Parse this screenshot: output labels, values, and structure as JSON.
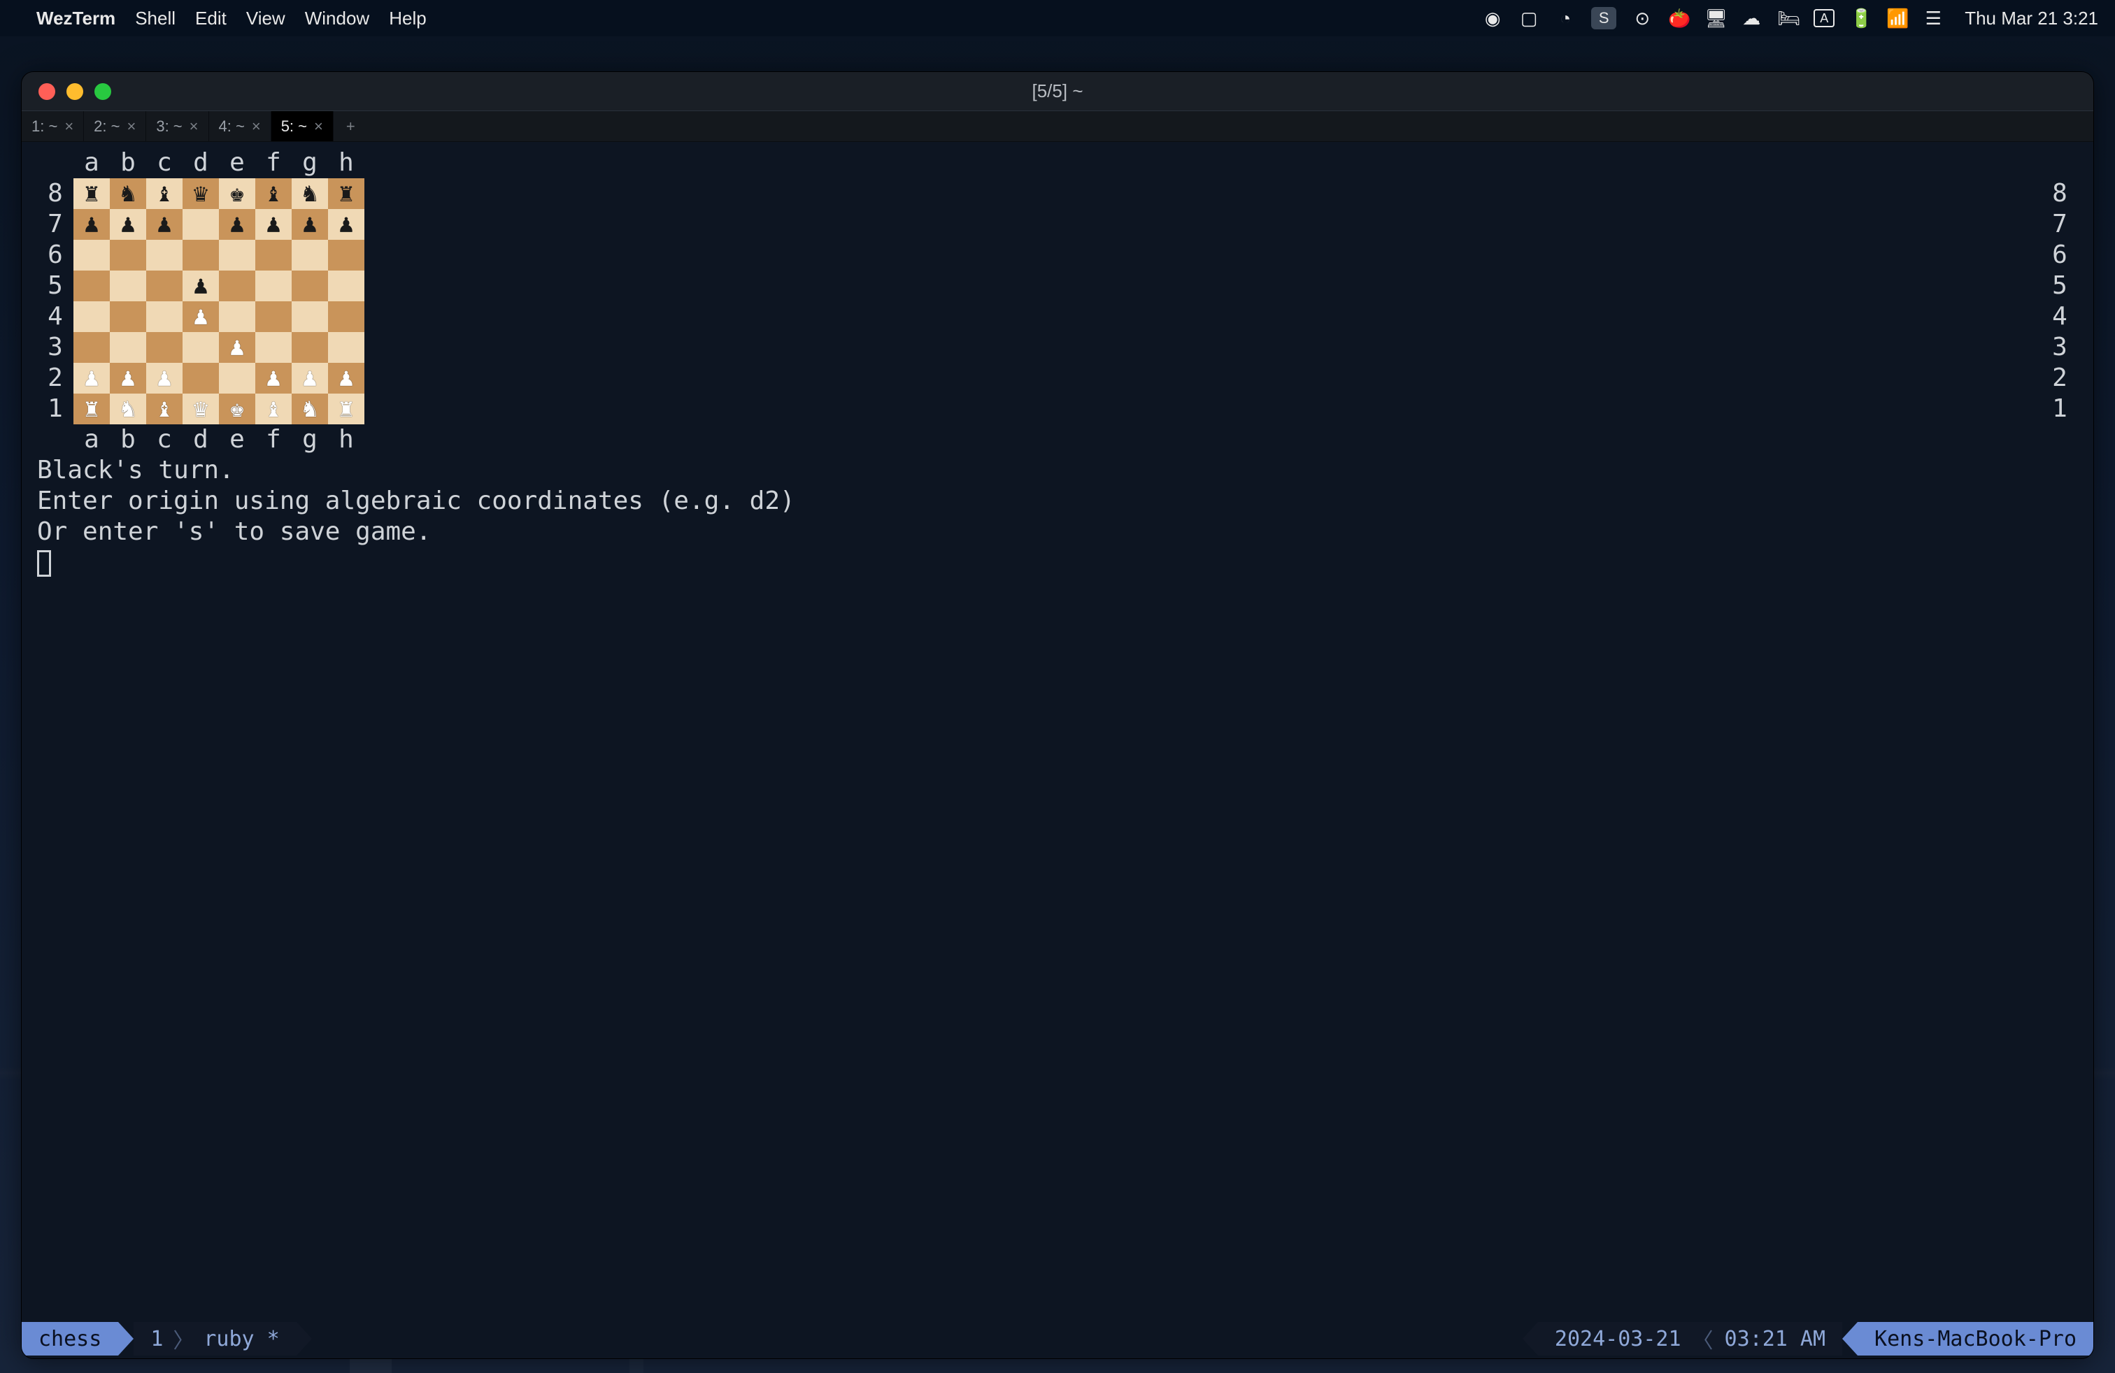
{
  "menubar": {
    "app": "WezTerm",
    "items": [
      "Shell",
      "Edit",
      "View",
      "Window",
      "Help"
    ],
    "clock": "Thu Mar 21  3:21",
    "tray_icons": [
      "sync-icon",
      "tablet-icon",
      "timer-icon",
      "s-app-icon",
      "record-icon",
      "tomato-icon",
      "display-icon",
      "cloud-icon",
      "bed-icon",
      "input-a-icon",
      "battery-icon",
      "wifi-icon",
      "control-center-icon"
    ]
  },
  "window": {
    "title": "[5/5] ~",
    "tabs": [
      {
        "label": "1: ~",
        "active": false
      },
      {
        "label": "2: ~",
        "active": false
      },
      {
        "label": "3: ~",
        "active": false
      },
      {
        "label": "4: ~",
        "active": false
      },
      {
        "label": "5: ~",
        "active": true
      }
    ]
  },
  "chess": {
    "files": [
      "a",
      "b",
      "c",
      "d",
      "e",
      "f",
      "g",
      "h"
    ],
    "ranks": [
      "8",
      "7",
      "6",
      "5",
      "4",
      "3",
      "2",
      "1"
    ],
    "light_square": "#f0d9b5",
    "dark_square": "#c9945a",
    "white_piece_color": "#ffffff",
    "black_piece_color": "#1a1a1a",
    "board": [
      [
        "br",
        "bn",
        "bb",
        "bq",
        "bk",
        "bb",
        "bn",
        "br"
      ],
      [
        "bp",
        "bp",
        "bp",
        "",
        "bp",
        "bp",
        "bp",
        "bp"
      ],
      [
        "",
        "",
        "",
        "",
        "",
        "",
        "",
        ""
      ],
      [
        "",
        "",
        "",
        "bp",
        "",
        "",
        "",
        ""
      ],
      [
        "",
        "",
        "",
        "wp",
        "",
        "",
        "",
        ""
      ],
      [
        "",
        "",
        "",
        "",
        "wp",
        "",
        "",
        ""
      ],
      [
        "wp",
        "wp",
        "wp",
        "",
        "",
        "wp",
        "wp",
        "wp"
      ],
      [
        "wr",
        "wn",
        "wb",
        "wq",
        "wk",
        "wb",
        "wn",
        "wr"
      ]
    ],
    "turn_line": "Black's turn.",
    "prompt_line1": "Enter origin using algebraic coordinates (e.g. d2)",
    "prompt_line2": "Or enter 's' to save game."
  },
  "statusbar": {
    "session": "chess",
    "pane": "1",
    "proc": "ruby *",
    "date": "2024-03-21",
    "time": "03:21 AM",
    "host": "Kens-MacBook-Pro"
  }
}
